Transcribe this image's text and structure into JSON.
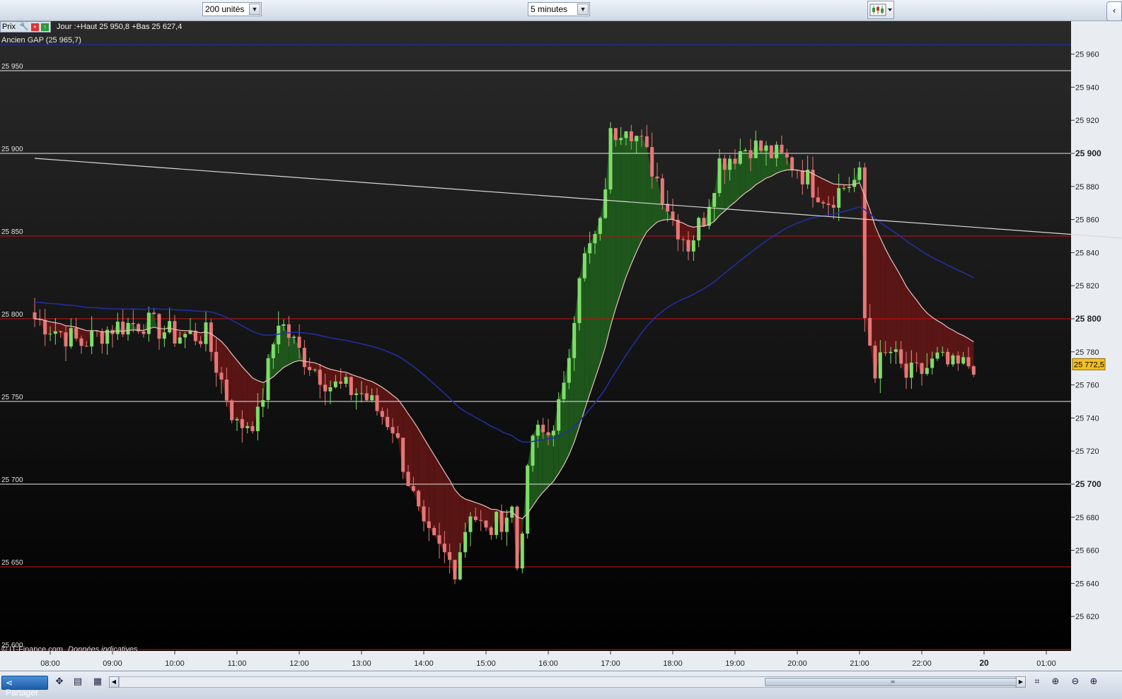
{
  "toolbar": {
    "units_value": "200 unités",
    "interval_value": "5 minutes",
    "chart_type_icon": "candlestick-chart-icon",
    "right_tab_icon": "chevron-left-icon"
  },
  "legend": {
    "price_label": "Prix",
    "day_info": "Jour :+Haut 25 950,8 +Bas 25 627,4",
    "gap_label": "Ancien GAP (25 965,7)"
  },
  "watermark": {
    "site": "© IT-Finance.com",
    "note": "Données indicatives"
  },
  "bottombar": {
    "share_label": "Partager",
    "share_icon": "share-icon",
    "tool_icons": [
      "cursor-tool-icon",
      "drawing-list-icon",
      "indicator-grid-icon"
    ],
    "zoom_icons": [
      "chart-tool-icon",
      "zoom-fit-icon",
      "zoom-out-icon",
      "zoom-in-icon"
    ]
  },
  "colors": {
    "background_top": "#2a2a2a",
    "background_bottom": "#000000",
    "bull": "#7fdc6a",
    "bear": "#e57878",
    "fill_bull": "#1f5a1c",
    "fill_bear": "#5e1515",
    "ma_fast": "#e8c0bc",
    "ma_slow": "#2030a8",
    "level_white": "#e8e8e8",
    "level_red": "#cc1010",
    "gap_line": "#1830b0",
    "current_price_bg": "#f4c020"
  },
  "chart_data": {
    "type": "candlestick",
    "interval": "5 minutes",
    "y_range": [
      25600,
      25968
    ],
    "x_ticks": [
      "08:00",
      "09:00",
      "10:00",
      "11:00",
      "12:00",
      "13:00",
      "14:00",
      "15:00",
      "16:00",
      "17:00",
      "18:00",
      "19:00",
      "20:00",
      "21:00",
      "22:00",
      "20",
      "01:00"
    ],
    "y_ticks_right": [
      {
        "value": 25960,
        "label": "25 960",
        "bold": false
      },
      {
        "value": 25940,
        "label": "25 940",
        "bold": false
      },
      {
        "value": 25920,
        "label": "25 920",
        "bold": false
      },
      {
        "value": 25900,
        "label": "25 900",
        "bold": true
      },
      {
        "value": 25880,
        "label": "25 880",
        "bold": false
      },
      {
        "value": 25860,
        "label": "25 860",
        "bold": false
      },
      {
        "value": 25840,
        "label": "25 840",
        "bold": false
      },
      {
        "value": 25820,
        "label": "25 820",
        "bold": false
      },
      {
        "value": 25800,
        "label": "25 800",
        "bold": true
      },
      {
        "value": 25780,
        "label": "25 780",
        "bold": false
      },
      {
        "value": 25760,
        "label": "25 760",
        "bold": false
      },
      {
        "value": 25740,
        "label": "25 740",
        "bold": false
      },
      {
        "value": 25720,
        "label": "25 720",
        "bold": false
      },
      {
        "value": 25700,
        "label": "25 700",
        "bold": true
      },
      {
        "value": 25680,
        "label": "25 680",
        "bold": false
      },
      {
        "value": 25660,
        "label": "25 660",
        "bold": false
      },
      {
        "value": 25640,
        "label": "25 640",
        "bold": false
      },
      {
        "value": 25620,
        "label": "25 620",
        "bold": false
      }
    ],
    "levels": [
      {
        "value": 25965.7,
        "color": "gap"
      },
      {
        "value": 25950,
        "label": "25 950",
        "color": "white"
      },
      {
        "value": 25900,
        "label": "25 900",
        "color": "white"
      },
      {
        "value": 25850,
        "label": "25 850",
        "color": "red"
      },
      {
        "value": 25800,
        "label": "25 800",
        "color": "red"
      },
      {
        "value": 25750,
        "label": "25 750",
        "color": "white"
      },
      {
        "value": 25700,
        "label": "25 700",
        "color": "white"
      },
      {
        "value": 25650,
        "label": "25 650",
        "color": "red"
      },
      {
        "value": 25600,
        "label": "25 600",
        "color": "red"
      }
    ],
    "current_price": {
      "value": 25772.5,
      "label": "25 772,5"
    },
    "trendline": {
      "from": {
        "time": "07:45",
        "price": 25897
      },
      "to": {
        "time": "01:30",
        "price": 25848
      }
    },
    "session_high": 25950.8,
    "session_low": 25627.4,
    "key_points": [
      [
        "07:45",
        25800
      ],
      [
        "08:30",
        25785
      ],
      [
        "09:00",
        25795
      ],
      [
        "09:30",
        25798
      ],
      [
        "10:00",
        25790
      ],
      [
        "10:30",
        25790
      ],
      [
        "11:00",
        25735
      ],
      [
        "11:20",
        25740
      ],
      [
        "11:40",
        25800
      ],
      [
        "12:00",
        25780
      ],
      [
        "12:30",
        25760
      ],
      [
        "13:00",
        25755
      ],
      [
        "13:30",
        25735
      ],
      [
        "14:00",
        25670
      ],
      [
        "14:30",
        25650
      ],
      [
        "14:45",
        25685
      ],
      [
        "15:00",
        25670
      ],
      [
        "15:25",
        25685
      ],
      [
        "15:30",
        25650
      ],
      [
        "15:45",
        25730
      ],
      [
        "16:00",
        25730
      ],
      [
        "16:15",
        25755
      ],
      [
        "16:30",
        25830
      ],
      [
        "16:50",
        25855
      ],
      [
        "17:00",
        25910
      ],
      [
        "17:15",
        25920
      ],
      [
        "17:30",
        25905
      ],
      [
        "17:45",
        25885
      ],
      [
        "18:00",
        25860
      ],
      [
        "18:15",
        25845
      ],
      [
        "18:30",
        25862
      ],
      [
        "18:45",
        25895
      ],
      [
        "19:00",
        25900
      ],
      [
        "19:15",
        25905
      ],
      [
        "19:45",
        25897
      ],
      [
        "20:00",
        25892
      ],
      [
        "20:15",
        25880
      ],
      [
        "20:30",
        25872
      ],
      [
        "20:45",
        25880
      ],
      [
        "21:00",
        25885
      ],
      [
        "21:05",
        25800
      ],
      [
        "21:15",
        25770
      ],
      [
        "21:30",
        25780
      ],
      [
        "21:45",
        25765
      ],
      [
        "22:00",
        25768
      ],
      [
        "22:15",
        25775
      ],
      [
        "22:30",
        25770
      ],
      [
        "22:50",
        25773
      ]
    ]
  }
}
